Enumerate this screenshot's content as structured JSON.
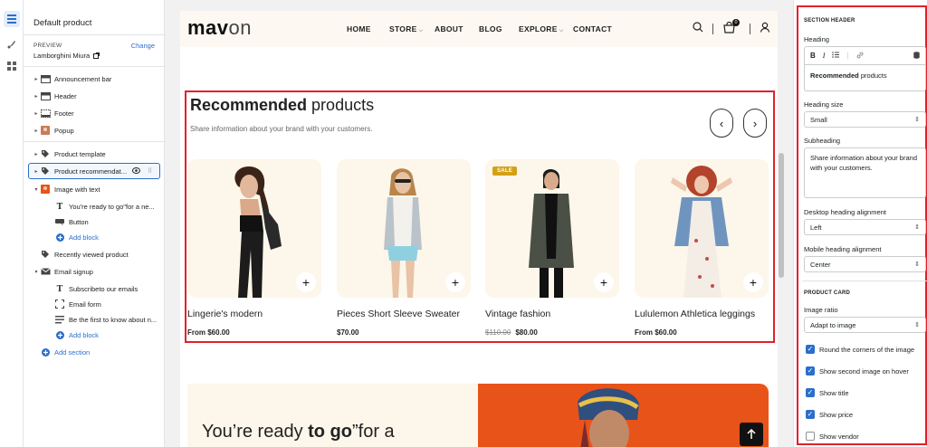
{
  "sidebar": {
    "title": "Default product",
    "preview_label": "PREVIEW",
    "change_label": "Change",
    "preview_value": "Lamborghini Miura",
    "items": [
      {
        "label": "Announcement bar"
      },
      {
        "label": "Header"
      },
      {
        "label": "Footer"
      },
      {
        "label": "Popup"
      },
      {
        "label": "Product template"
      },
      {
        "label": "Product recommendat..."
      },
      {
        "label": "Image with text"
      },
      {
        "label": "You're ready to go\"for a ne..."
      },
      {
        "label": "Button"
      },
      {
        "label": "Add block"
      },
      {
        "label": "Recently viewed product"
      },
      {
        "label": "Email signup"
      },
      {
        "label": "Subscribeto our emails"
      },
      {
        "label": "Email form"
      },
      {
        "label": "Be the first to know about n..."
      },
      {
        "label": "Add block"
      },
      {
        "label": "Add section"
      }
    ]
  },
  "store": {
    "logo_main": "mav",
    "logo_end": "on",
    "nav": [
      "HOME",
      "STORE",
      "ABOUT",
      "BLOG",
      "EXPLORE",
      "CONTACT"
    ],
    "cart_count": "0"
  },
  "recommended": {
    "heading_bold": "Recommended",
    "heading_rest": " products",
    "subheading": "Share information about your brand with your customers.",
    "products": [
      {
        "name": "Lingerie's modern",
        "price": "From $60.00",
        "old_price": "",
        "badge": ""
      },
      {
        "name": "Pieces Short Sleeve Sweater",
        "price": "$70.00",
        "old_price": "",
        "badge": ""
      },
      {
        "name": "Vintage fashion",
        "price": "$80.00",
        "old_price": "$110.00",
        "badge": "SALE"
      },
      {
        "name": "Lululemon Athletica leggings",
        "price": "From $60.00",
        "old_price": "",
        "badge": ""
      }
    ]
  },
  "banner": {
    "text_start": "You’re ready ",
    "text_bold": "to go",
    "text_end": "”for a"
  },
  "panel": {
    "section_header": "SECTION HEADER",
    "heading_label": "Heading",
    "heading_bold": "Recommended",
    "heading_rest": " products",
    "heading_size_label": "Heading size",
    "heading_size_value": "Small",
    "subheading_label": "Subheading",
    "subheading_value": "Share information about your brand with your customers.",
    "desktop_align_label": "Desktop heading alignment",
    "desktop_align_value": "Left",
    "mobile_align_label": "Mobile heading alignment",
    "mobile_align_value": "Center",
    "product_card": "PRODUCT CARD",
    "image_ratio_label": "Image ratio",
    "image_ratio_value": "Adapt to image",
    "checkboxes": [
      {
        "label": "Round the corners of the image",
        "checked": true
      },
      {
        "label": "Show second image on hover",
        "checked": true
      },
      {
        "label": "Show title",
        "checked": true
      },
      {
        "label": "Show price",
        "checked": true
      },
      {
        "label": "Show vendor",
        "checked": false
      }
    ]
  },
  "colors": {
    "accent": "#2c6ecb",
    "highlight": "#e3202a",
    "sale": "#d4a015",
    "banner": "#e8531a"
  }
}
